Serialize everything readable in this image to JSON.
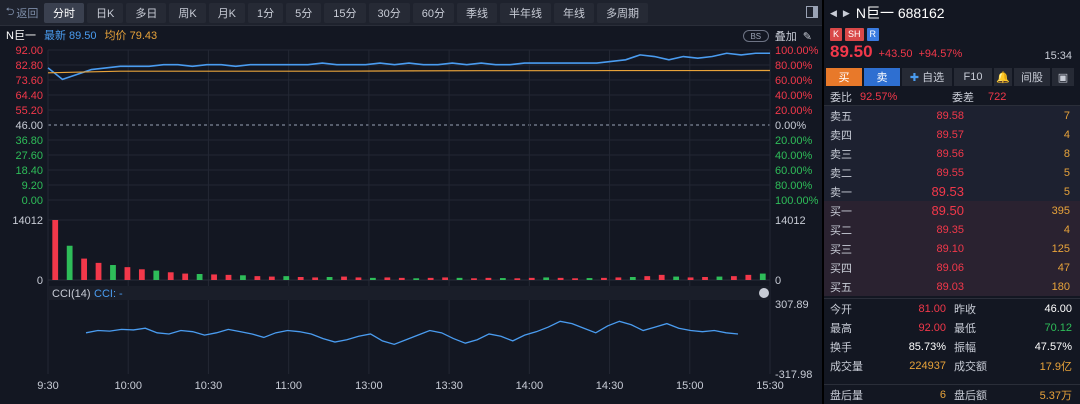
{
  "toolbar": {
    "back_label": "返回",
    "tabs": [
      {
        "label": "分时",
        "active": true
      },
      {
        "label": "日K"
      },
      {
        "label": "多日"
      },
      {
        "label": "周K"
      },
      {
        "label": "月K"
      },
      {
        "label": "1分"
      },
      {
        "label": "5分"
      },
      {
        "label": "15分"
      },
      {
        "label": "30分"
      },
      {
        "label": "60分"
      },
      {
        "label": "季线"
      },
      {
        "label": "半年线"
      },
      {
        "label": "年线"
      },
      {
        "label": "多周期"
      }
    ]
  },
  "info": {
    "name": "N巨一",
    "latest_label": "最新",
    "latest_value": "89.50",
    "avg_label": "均价",
    "avg_value": "79.43",
    "bs_label": "BS",
    "overlay_label": "叠加"
  },
  "chart_data": {
    "type": "line",
    "price_axis_left": [
      "92.00",
      "82.80",
      "73.60",
      "64.40",
      "55.20",
      "46.00",
      "36.80",
      "27.60",
      "18.40",
      "9.20",
      "0.00"
    ],
    "pct_axis_right": [
      "100.00%",
      "80.00%",
      "60.00%",
      "40.00%",
      "20.00%",
      "0.00%",
      "20.00%",
      "40.00%",
      "60.00%",
      "80.00%",
      "100.00%"
    ],
    "prev_close": 46.0,
    "ylim": [
      0,
      92
    ],
    "x_ticks": [
      "9:30",
      "10:00",
      "10:30",
      "11:00",
      "13:00",
      "13:30",
      "14:00",
      "14:30",
      "15:00",
      "15:30"
    ],
    "series": [
      {
        "name": "最新",
        "color": "#4a9cf0",
        "x": [
          0,
          2,
          4,
          6,
          8,
          10,
          12,
          14,
          16,
          18,
          20,
          22,
          24,
          26,
          28,
          30,
          32,
          34,
          36,
          38,
          40,
          42,
          44,
          46,
          48,
          50,
          52,
          54,
          56,
          58,
          60,
          62,
          64,
          66,
          68,
          70,
          72,
          74,
          76,
          78,
          80,
          82,
          84,
          86,
          88,
          90,
          92,
          94,
          96,
          98,
          100
        ],
        "values": [
          81,
          74,
          77,
          80,
          81,
          82,
          82,
          82,
          83,
          83,
          82,
          83,
          83,
          82,
          83,
          83,
          83,
          83,
          83,
          84,
          83,
          83,
          83,
          84,
          83,
          84,
          83,
          83,
          84,
          83,
          84,
          83,
          83,
          84,
          84,
          84,
          84,
          84,
          84,
          85,
          86,
          89,
          88,
          86,
          88,
          87,
          88,
          90,
          89,
          90,
          90
        ]
      },
      {
        "name": "均价",
        "color": "#e8a33a",
        "x": [
          0,
          10,
          20,
          30,
          40,
          50,
          60,
          70,
          80,
          90,
          100
        ],
        "values": [
          78,
          79,
          79,
          79,
          79,
          79.2,
          79.3,
          79.3,
          79.4,
          79.4,
          79.43
        ]
      }
    ],
    "volume": {
      "axis_top": "14012",
      "axis_zero": "0",
      "bars": [
        14012,
        8000,
        5000,
        4000,
        3500,
        3000,
        2500,
        2200,
        1800,
        1500,
        1400,
        1300,
        1200,
        1100,
        900,
        800,
        900,
        700,
        600,
        700,
        800,
        600,
        500,
        600,
        500,
        400,
        500,
        600,
        500,
        400,
        500,
        450,
        400,
        500,
        600,
        500,
        400,
        450,
        500,
        600,
        700,
        900,
        1200,
        800,
        600,
        700,
        800,
        900,
        1200,
        1500
      ]
    },
    "cci": {
      "title": "CCI(14)",
      "value_label": "CCI: -",
      "axis_top": "307.89",
      "axis_bottom": "-317.98",
      "values": [
        40,
        60,
        55,
        70,
        65,
        80,
        40,
        30,
        60,
        50,
        20,
        40,
        70,
        50,
        30,
        0,
        40,
        60,
        50,
        30,
        -10,
        -40,
        -20,
        10,
        30,
        -30,
        -60,
        -20,
        20,
        60,
        40,
        -10,
        -50,
        -20,
        30,
        10,
        -30,
        20,
        50,
        90,
        140,
        120,
        80,
        40,
        100,
        140,
        110,
        60,
        90,
        120,
        80,
        60,
        50,
        60,
        40,
        30
      ]
    }
  },
  "rpanel": {
    "title": "N巨一  688162",
    "tags": [
      "K",
      "SH",
      "R"
    ],
    "price": "89.50",
    "chg": "+43.50",
    "chg_pct": "+94.57%",
    "time": "15:34",
    "actions": [
      "买",
      "卖",
      "自选",
      "F10",
      "",
      "间股"
    ],
    "wb_label": "委比",
    "wb_value": "92.57%",
    "wc_label": "委差",
    "wc_value": "722",
    "asks": [
      {
        "name": "卖五",
        "price": "89.58",
        "qty": "7"
      },
      {
        "name": "卖四",
        "price": "89.57",
        "qty": "4"
      },
      {
        "name": "卖三",
        "price": "89.56",
        "qty": "8"
      },
      {
        "name": "卖二",
        "price": "89.55",
        "qty": "5"
      },
      {
        "name": "卖一",
        "price": "89.53",
        "qty": "5"
      }
    ],
    "bids": [
      {
        "name": "买一",
        "price": "89.50",
        "qty": "395"
      },
      {
        "name": "买二",
        "price": "89.35",
        "qty": "4"
      },
      {
        "name": "买三",
        "price": "89.10",
        "qty": "125"
      },
      {
        "name": "买四",
        "price": "89.06",
        "qty": "47"
      },
      {
        "name": "买五",
        "price": "89.03",
        "qty": "180"
      }
    ],
    "stats": [
      {
        "l1": "今开",
        "v1": "81.00",
        "l2": "昨收",
        "v2": "46.00"
      },
      {
        "l1": "最高",
        "v1": "92.00",
        "l2": "最低",
        "v2": "70.12"
      },
      {
        "l1": "换手",
        "v1": "85.73%",
        "l2": "振幅",
        "v2": "47.57%"
      },
      {
        "l1": "成交量",
        "v1": "224937",
        "l2": "成交额",
        "v2": "17.9亿"
      }
    ],
    "after": {
      "l1": "盘后量",
      "v1": "6",
      "l2": "盘后额",
      "v2": "5.37万"
    }
  }
}
